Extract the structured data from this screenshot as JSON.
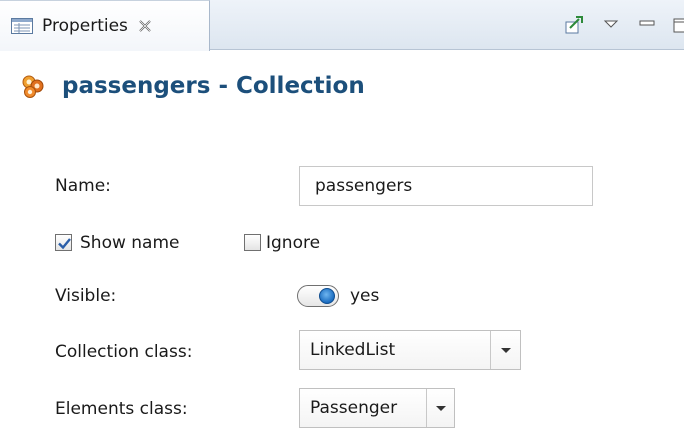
{
  "tab": {
    "title": "Properties",
    "icon": "properties-icon",
    "close_icon": "close-icon"
  },
  "view_tools": [
    "pin-to-selection-icon",
    "view-menu-icon",
    "minimize-icon",
    "maximize-icon"
  ],
  "header": {
    "icon": "collection-icon",
    "title": "passengers - Collection"
  },
  "form": {
    "name_label": "Name:",
    "name_value": "passengers",
    "show_name_label": "Show name",
    "show_name_checked": true,
    "ignore_label": "Ignore",
    "ignore_checked": false,
    "visible_label": "Visible:",
    "visible_value": "yes",
    "collection_class_label": "Collection class:",
    "collection_class_value": "LinkedList",
    "elements_class_label": "Elements class:",
    "elements_class_value": "Passenger"
  },
  "colors": {
    "header_title": "#1c4f7b",
    "toggle_knob": "#1a6cc0",
    "checkbox_check": "#2a5ea8"
  }
}
